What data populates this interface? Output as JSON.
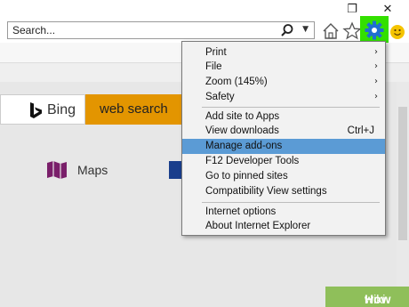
{
  "window": {
    "restore_glyph": "❐",
    "close_glyph": "✕"
  },
  "address_bar": {
    "placeholder": "Search...",
    "search_icon": "search-icon",
    "dropdown_icon": "chevron-down-icon"
  },
  "toolbar_icons": [
    "home-icon",
    "star-icon",
    "gear-icon",
    "smiley-icon"
  ],
  "colors": {
    "gear_highlight": "#33e000",
    "gear": "#1f6fd1",
    "menu_highlight": "#5b9bd5",
    "web_search": "#e39500",
    "maps_icon": "#7a1f6a",
    "wikihow_green": "#8fbf5a"
  },
  "page": {
    "bing_label": "Bing",
    "web_search_label": "web search",
    "maps_label": "Maps"
  },
  "menu": {
    "items": [
      {
        "label": "Print",
        "submenu": true
      },
      {
        "label": "File",
        "submenu": true
      },
      {
        "label": "Zoom (145%)",
        "submenu": true
      },
      {
        "label": "Safety",
        "submenu": true
      },
      {
        "label": "Add site to Apps"
      },
      {
        "label": "View downloads",
        "shortcut": "Ctrl+J"
      },
      {
        "label": "Manage add-ons",
        "highlighted": true
      },
      {
        "label": "F12 Developer Tools"
      },
      {
        "label": "Go to pinned sites"
      },
      {
        "label": "Compatibility View settings"
      },
      {
        "label": "Internet options"
      },
      {
        "label": "About Internet Explorer"
      }
    ],
    "arrow_glyph": "›"
  },
  "watermark": {
    "wiki": "wiki",
    "how": "How"
  }
}
